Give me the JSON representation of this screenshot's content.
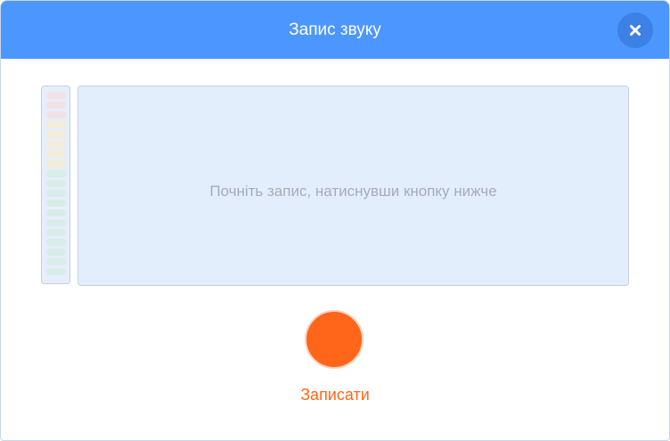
{
  "dialog": {
    "title": "Запис звуку",
    "close_icon": "close-icon"
  },
  "recorder": {
    "hint": "Почніть запис, натиснувши кнопку нижче",
    "record_label": "Записати",
    "level": 0
  },
  "colors": {
    "header": "#4c97ff",
    "close_button": "#3d80e6",
    "record_button": "#ff6619",
    "meter_red": "#f2e2e6",
    "meter_yellow": "#f2ecd9",
    "meter_green": "#d9ede8"
  }
}
